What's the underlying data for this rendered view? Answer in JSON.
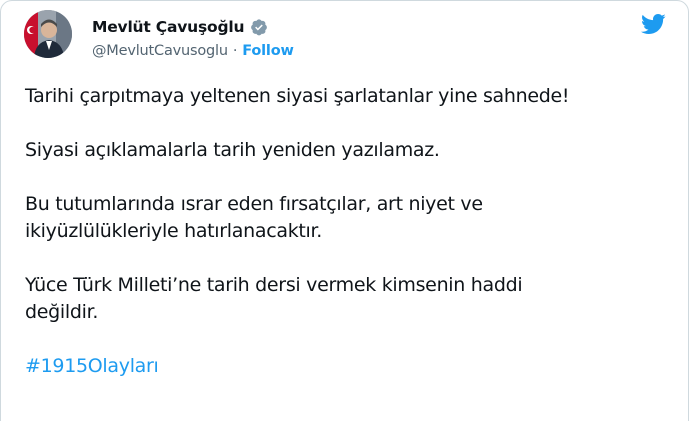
{
  "author": {
    "name": "Mevlüt Çavuşoğlu",
    "handle": "@MevlutCavusoglu",
    "separator": "·",
    "follow_label": "Follow",
    "verified": true
  },
  "icons": {
    "verified": "verified-badge-icon",
    "platform": "twitter-bird-icon"
  },
  "colors": {
    "accent": "#1d9bf0",
    "text": "#0f1419",
    "secondary": "#536471",
    "verified": "#829aab"
  },
  "tweet": {
    "paragraphs": [
      [
        "Tarihi çarpıtmaya yeltenen siyasi şarlatanlar yine sahnede!"
      ],
      [
        "Siyasi açıklamalarla tarih yeniden yazılamaz."
      ],
      [
        "Bu tutumlarında ısrar eden fırsatçılar, art niyet ve",
        "ikiyüzlülükleriyle hatırlanacaktır."
      ],
      [
        "Yüce Türk Milleti’ne tarih dersi vermek kimsenin haddi",
        "değildir."
      ]
    ],
    "hashtag": "#1915Olayları"
  }
}
